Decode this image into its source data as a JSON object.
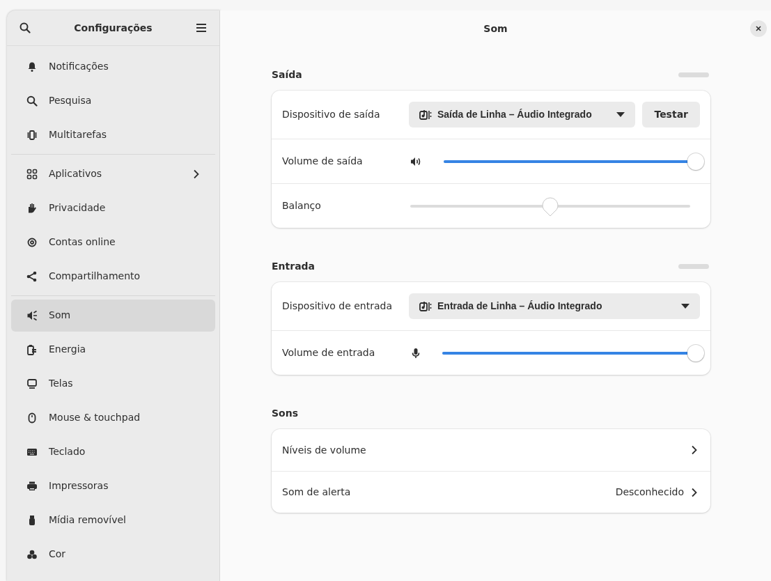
{
  "sidebar": {
    "title": "Configurações",
    "groups": [
      [
        {
          "label": "Notificações",
          "selected": false
        },
        {
          "label": "Pesquisa",
          "selected": false
        },
        {
          "label": "Multitarefas",
          "selected": false
        }
      ],
      [
        {
          "label": "Aplicativos",
          "selected": false,
          "submenu": true
        },
        {
          "label": "Privacidade",
          "selected": false
        },
        {
          "label": "Contas online",
          "selected": false
        },
        {
          "label": "Compartilhamento",
          "selected": false
        }
      ],
      [
        {
          "label": "Som",
          "selected": true
        },
        {
          "label": "Energia",
          "selected": false
        },
        {
          "label": "Telas",
          "selected": false
        },
        {
          "label": "Mouse & touchpad",
          "selected": false
        },
        {
          "label": "Teclado",
          "selected": false
        },
        {
          "label": "Impressoras",
          "selected": false
        },
        {
          "label": "Mídia removível",
          "selected": false
        },
        {
          "label": "Cor",
          "selected": false
        }
      ]
    ]
  },
  "page": {
    "title": "Som"
  },
  "sections": [
    {
      "title": "Saída",
      "meter": {
        "level": 0
      },
      "rows": [
        {
          "kind": "dropdown",
          "label": "Dispositivo de saída",
          "value": "Saída de Linha – Áudio Integrado",
          "button": "Testar"
        },
        {
          "kind": "slider",
          "label": "Volume de saída",
          "level": 1
        },
        {
          "kind": "balance",
          "label": "Balanço",
          "level": 0.5
        }
      ]
    },
    {
      "title": "Entrada",
      "meter": {
        "level": 0
      },
      "rows": [
        {
          "kind": "dropdown",
          "label": "Dispositivo de entrada",
          "value": "Entrada de Linha – Áudio Integrado"
        },
        {
          "kind": "slider",
          "label": "Volume de entrada",
          "level": 1
        }
      ]
    },
    {
      "title": "Sons",
      "rows": [
        {
          "kind": "link",
          "label": "Níveis de volume"
        },
        {
          "kind": "link",
          "label": "Som de alerta",
          "value": "Desconhecido"
        }
      ]
    }
  ]
}
